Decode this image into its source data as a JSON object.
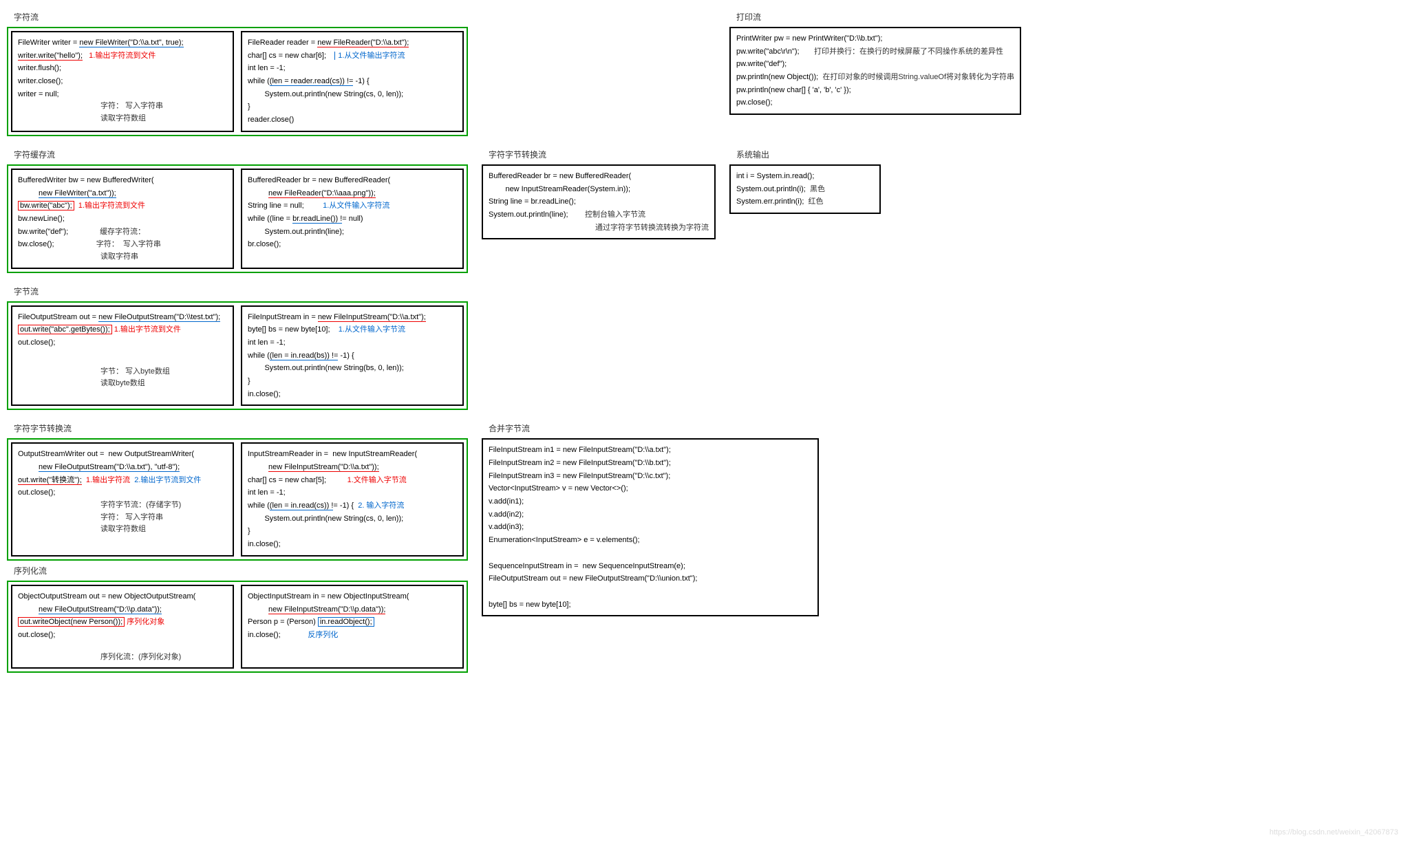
{
  "s1": {
    "title": "字符流",
    "left": {
      "l1a": "FileWriter writer = ",
      "l1b": "new FileWriter(\"D:\\\\a.txt\", true);",
      "l2": "writer.write(\"hello\");",
      "a1": "1.输出字符流到文件",
      "l3": "writer.flush();",
      "l4": "writer.close();",
      "l5": "writer = null;",
      "n1": "字符：  写入字符串",
      "n2": "          读取字符数组"
    },
    "right": {
      "l1a": "FileReader reader = ",
      "l1b": "new FileReader(\"D:\\\\a.txt\");",
      "l2": "char[] cs = new char[6];",
      "a1": "1.从文件输出字符流",
      "l3": "int len = -1;",
      "l4a": "while (",
      "l4b": "(len = reader.read(cs)) !=",
      "l4c": " -1) {",
      "l5": "        System.out.println(new String(cs, 0, len));",
      "l6": "}",
      "l7": "reader.close()"
    }
  },
  "s2": {
    "title": "打印流",
    "l1": "PrintWriter pw = new PrintWriter(\"D:\\\\b.txt\");",
    "l2": "pw.write(\"abc\\r\\n\");",
    "a2": "打印并换行：在换行的时候屏蔽了不同操作系统的差异性",
    "l3": "pw.write(\"def\");",
    "l4": "pw.println(new Object());",
    "a4": "在打印对象的时候调用String.valueOf将对象转化为字符串",
    "l5": "pw.println(new char[] { 'a', 'b', 'c' });",
    "l6": "pw.close();"
  },
  "s3": {
    "title": "字符缓存流",
    "left": {
      "l1": "BufferedWriter bw = new BufferedWriter(",
      "l2": "new FileWriter(\"a.txt\"));",
      "l3": "bw.write(\"abc\");",
      "a1": "1.输出字符流到文件",
      "l4": "bw.newLine();",
      "l5": "bw.write(\"def\");",
      "n1": "缓存字符流：",
      "l6": "bw.close();",
      "n2": "字符：  写入字符串",
      "n3": "          读取字符串"
    },
    "right": {
      "l1": "BufferedReader br = new BufferedReader(",
      "l2": "new FileReader(\"D:\\\\aaa.png\"));",
      "l3": "String line = null;",
      "a1": "1.从文件输入字符流",
      "l4a": "while ((line = ",
      "l4b": "br.readLine()) !",
      "l4c": "= null)",
      "l5": "        System.out.println(line);",
      "l6": "br.close();"
    }
  },
  "s4": {
    "title": "字符字节转换流",
    "l1": "BufferedReader br = new BufferedReader(",
    "l2": "        new InputStreamReader(System.in));",
    "l3": "String line = br.readLine();",
    "l4": "System.out.println(line);",
    "n1": "控制台输入字节流",
    "n2": "通过字符字节转换流转换为字符流"
  },
  "s5": {
    "title": "系统输出",
    "l1": "int i = System.in.read();",
    "l2": "System.out.println(i);",
    "a2": "黑色",
    "l3": "System.err.println(i);",
    "a3": "红色"
  },
  "s6": {
    "title": "字节流",
    "left": {
      "l1a": "FileOutputStream out = ",
      "l1b": "new FileOutputStream(\"D:\\\\test.txt\");",
      "l2": "out.write(\"abc\".getBytes());",
      "a1": "1.输出字节流到文件",
      "l3": "out.close();",
      "n1": "字节：  写入byte数组",
      "n2": "          读取byte数组"
    },
    "right": {
      "l1a": "FileInputStream in = ",
      "l1b": "new FileInputStream(\"D:\\\\a.txt\");",
      "l2": "byte[] bs = new byte[10];",
      "a1": "1.从文件输入字节流",
      "l3": "int len = -1;",
      "l4a": "while (",
      "l4b": "(len = in.read(bs)) !=",
      "l4c": " -1) {",
      "l5": "        System.out.println(new String(bs, 0, len));",
      "l6": "}",
      "l7": "in.close();"
    }
  },
  "s7": {
    "title": "字符字节转换流",
    "left": {
      "l1": "OutputStreamWriter out =  new OutputStreamWriter(",
      "l2": "new FileOutputStream(\"D:\\\\a.txt\"), \"utf-8\");",
      "l3": "out.write(\"转换流\");",
      "a1": "1.输出字符流",
      "a2": "2.输出字节流到文件",
      "l4": "out.close();",
      "n1": "字符字节流：(存储字节)",
      "n2": "字符：  写入字符串",
      "n3": "          读取字符数组"
    },
    "right": {
      "l1": "InputStreamReader in =  new InputStreamReader(",
      "l2": "new FileInputStream(\"D:\\\\a.txt\"));",
      "l3": "char[] cs = new char[5];",
      "a1": "1.文件输入字节流",
      "l4": "int len = -1;",
      "l5a": "while (",
      "l5b": "(len = in.read(cs)) !",
      "l5c": "= -1) {",
      "a2": "2. 输入字符流",
      "l6": "        System.out.println(new String(cs, 0, len));",
      "l7": "}",
      "l8": "in.close();"
    }
  },
  "s8": {
    "title": "合并字节流",
    "l1": "FileInputStream in1 = new FileInputStream(\"D:\\\\a.txt\");",
    "l2": "FileInputStream in2 = new FileInputStream(\"D:\\\\b.txt\");",
    "l3": "FileInputStream in3 = new FileInputStream(\"D:\\\\c.txt\");",
    "l4": "Vector<InputStream> v = new Vector<>();",
    "l5": "v.add(in1);",
    "l6": "v.add(in2);",
    "l7": "v.add(in3);",
    "l8": "Enumeration<InputStream> e = v.elements();",
    "l9": "",
    "l10": "SequenceInputStream in =  new SequenceInputStream(e);",
    "l11": "FileOutputStream out = new FileOutputStream(\"D:\\\\union.txt\");",
    "l12": "",
    "l13": "byte[] bs = new byte[10];"
  },
  "s9": {
    "title": "序列化流",
    "left": {
      "l1": "ObjectOutputStream out = new ObjectOutputStream(",
      "l2": "new FileOutputStream(\"D:\\\\p.data\"));",
      "l3": "out.writeObject(new Person());",
      "a1": "序列化对象",
      "l4": "out.close();",
      "n1": "序列化流：(序列化对象)"
    },
    "right": {
      "l1": "ObjectInputStream in = new ObjectInputStream(",
      "l2": "new FileInputStream(\"D:\\\\p.data\"));",
      "l3a": "Person p = (Person) ",
      "l3b": "in.readObject();",
      "l4": "in.close();",
      "a1": "反序列化"
    }
  },
  "wm": "https://blog.csdn.net/weixin_42067873"
}
